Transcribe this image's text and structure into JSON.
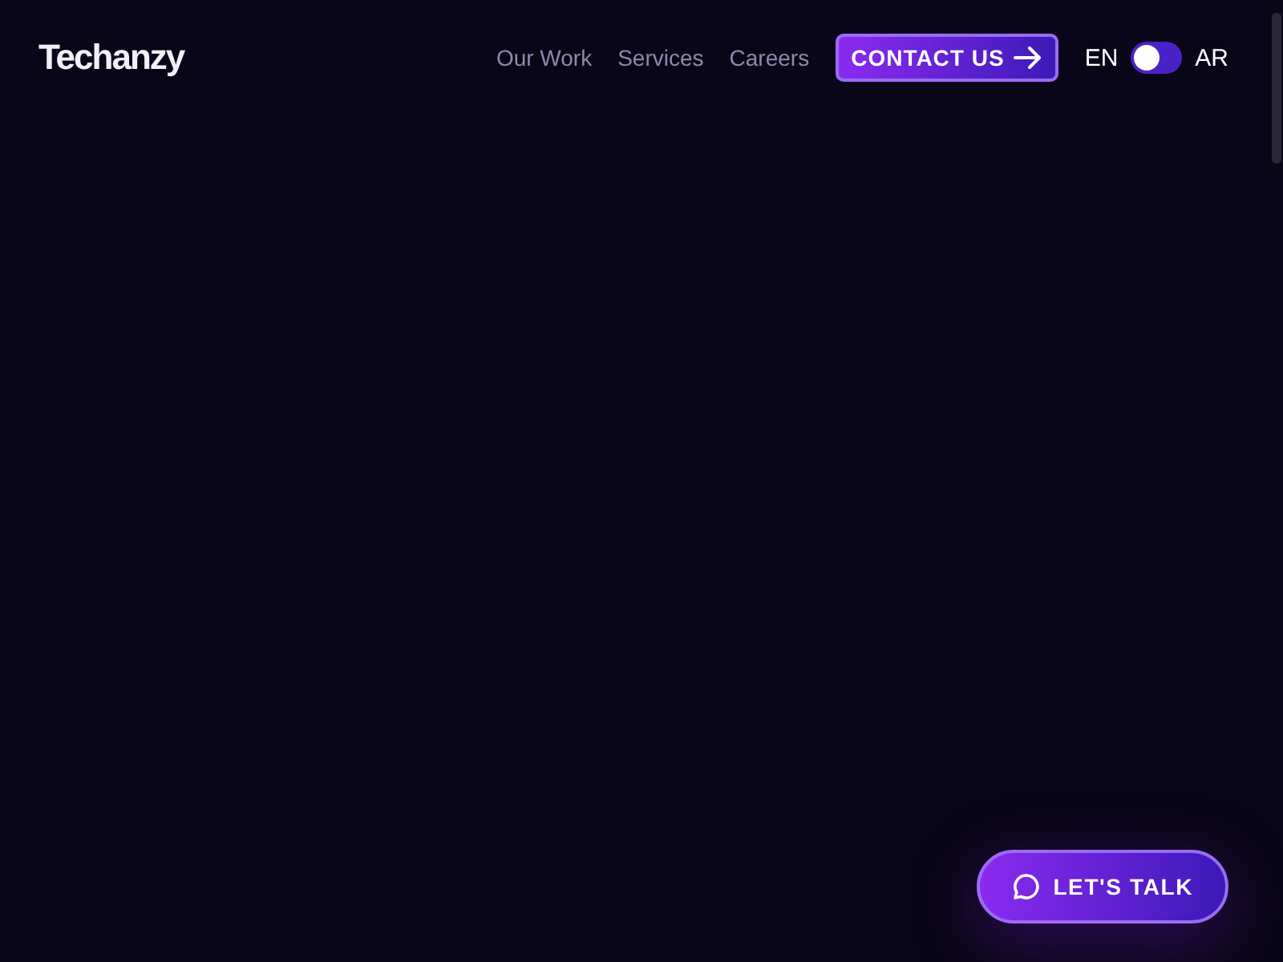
{
  "header": {
    "logo": "Techanzy",
    "nav": [
      {
        "label": "Our Work"
      },
      {
        "label": "Services"
      },
      {
        "label": "Careers"
      }
    ],
    "contact_button": {
      "label": "CONTACT US"
    },
    "language_toggle": {
      "left": "EN",
      "right": "AR",
      "on": false
    }
  },
  "chat_button": {
    "label": "LET'S TALK"
  }
}
